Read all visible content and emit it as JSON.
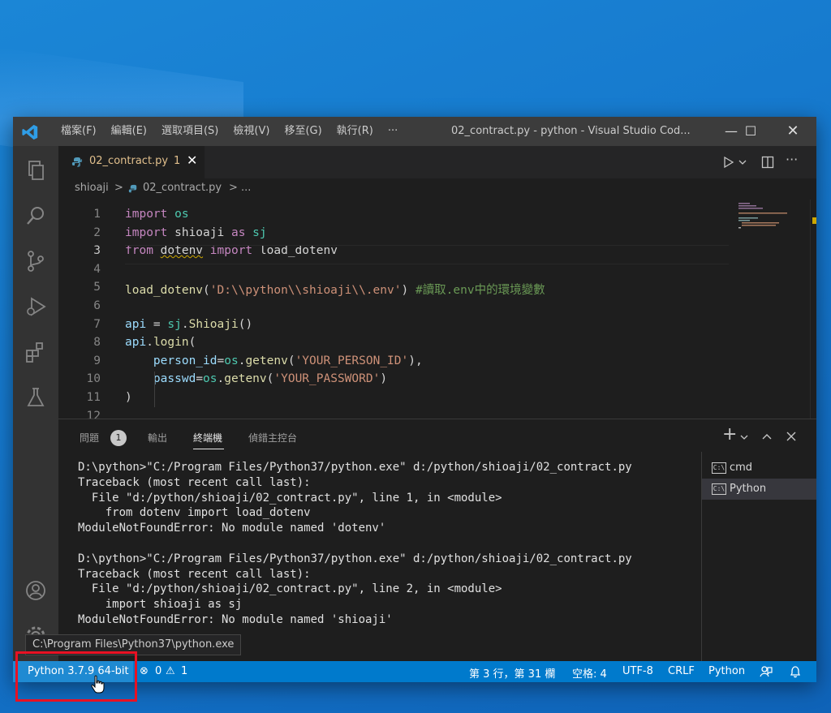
{
  "window": {
    "title": "02_contract.py - python - Visual Studio Cod...",
    "menu": [
      "檔案(F)",
      "編輯(E)",
      "選取項目(S)",
      "檢視(V)",
      "移至(G)",
      "執行(R)",
      "···"
    ],
    "minimize": "—",
    "maximize": "☐",
    "close": "✕"
  },
  "activity_bar": [
    "explorer-icon",
    "search-icon",
    "source-control-icon",
    "run-debug-icon",
    "extensions-icon",
    "testing-icon",
    "account-icon",
    "manage-gear-icon"
  ],
  "tab": {
    "label": "02_contract.py",
    "problems": "1",
    "close": "✕"
  },
  "breadcrumb": {
    "folder": "shioaji",
    "sep1": ">",
    "file": "02_contract.py",
    "sep2": "> ..."
  },
  "editor": {
    "line_numbers": [
      "1",
      "2",
      "3",
      "4",
      "5",
      "6",
      "7",
      "8",
      "9",
      "10",
      "11",
      "12"
    ],
    "current_line": 3,
    "lines": [
      [
        {
          "t": "import",
          "c": "kw"
        },
        {
          "t": " ",
          "c": "pl"
        },
        {
          "t": "os",
          "c": "mod"
        }
      ],
      [
        {
          "t": "import",
          "c": "kw"
        },
        {
          "t": " shioaji ",
          "c": "pl"
        },
        {
          "t": "as",
          "c": "kw"
        },
        {
          "t": " ",
          "c": "pl"
        },
        {
          "t": "sj",
          "c": "mod"
        }
      ],
      [
        {
          "t": "from",
          "c": "kw"
        },
        {
          "t": " ",
          "c": "pl"
        },
        {
          "t": "dotenv",
          "c": "pl",
          "u": true
        },
        {
          "t": " ",
          "c": "pl"
        },
        {
          "t": "import",
          "c": "kw"
        },
        {
          "t": " load_dotenv",
          "c": "pl"
        }
      ],
      [],
      [
        {
          "t": "load_dotenv",
          "c": "fn"
        },
        {
          "t": "(",
          "c": "pl"
        },
        {
          "t": "'D:\\\\python\\\\shioaji\\\\.env'",
          "c": "str"
        },
        {
          "t": ") ",
          "c": "pl"
        },
        {
          "t": "#讀取.env中的環境變數",
          "c": "cm"
        }
      ],
      [],
      [
        {
          "t": "api",
          "c": "var"
        },
        {
          "t": " = ",
          "c": "pl"
        },
        {
          "t": "sj",
          "c": "mod"
        },
        {
          "t": ".",
          "c": "pl"
        },
        {
          "t": "Shioaji",
          "c": "fn"
        },
        {
          "t": "()",
          "c": "pl"
        }
      ],
      [
        {
          "t": "api",
          "c": "var"
        },
        {
          "t": ".",
          "c": "pl"
        },
        {
          "t": "login",
          "c": "fn"
        },
        {
          "t": "(",
          "c": "pl"
        }
      ],
      [
        {
          "t": "    person_id",
          "c": "var"
        },
        {
          "t": "=",
          "c": "pl"
        },
        {
          "t": "os",
          "c": "mod"
        },
        {
          "t": ".",
          "c": "pl"
        },
        {
          "t": "getenv",
          "c": "fn"
        },
        {
          "t": "(",
          "c": "pl"
        },
        {
          "t": "'YOUR_PERSON_ID'",
          "c": "str"
        },
        {
          "t": "),",
          "c": "pl"
        }
      ],
      [
        {
          "t": "    passwd",
          "c": "var"
        },
        {
          "t": "=",
          "c": "pl"
        },
        {
          "t": "os",
          "c": "mod"
        },
        {
          "t": ".",
          "c": "pl"
        },
        {
          "t": "getenv",
          "c": "fn"
        },
        {
          "t": "(",
          "c": "pl"
        },
        {
          "t": "'YOUR_PASSWORD'",
          "c": "str"
        },
        {
          "t": ")",
          "c": "pl"
        }
      ],
      [
        {
          "t": ")",
          "c": "pl"
        }
      ],
      []
    ]
  },
  "panel": {
    "tabs": [
      "問題",
      "輸出",
      "終端機",
      "偵錯主控台"
    ],
    "problems_count": "1",
    "active_tab": "終端機",
    "add_terminal": "+",
    "terminals": [
      "cmd",
      "Python"
    ],
    "terminal_output": "D:\\python>\"C:/Program Files/Python37/python.exe\" d:/python/shioaji/02_contract.py\nTraceback (most recent call last):\n  File \"d:/python/shioaji/02_contract.py\", line 1, in <module>\n    from dotenv import load_dotenv\nModuleNotFoundError: No module named 'dotenv'\n\nD:\\python>\"C:/Program Files/Python37/python.exe\" d:/python/shioaji/02_contract.py\nTraceback (most recent call last):\n  File \"d:/python/shioaji/02_contract.py\", line 2, in <module>\n    import shioaji as sj\nModuleNotFoundError: No module named 'shioaji'"
  },
  "status_bar": {
    "interpreter": "Python 3.7.9 64-bit",
    "errors": "0",
    "warnings": "1",
    "position": "第 3 行，第 31 欄",
    "spaces": "空格: 4",
    "encoding": "UTF-8",
    "eol": "CRLF",
    "language": "Python"
  },
  "tooltip": "C:\\Program Files\\Python37\\python.exe",
  "colors": {
    "accent": "#007acc",
    "highlight": "#e81123"
  }
}
